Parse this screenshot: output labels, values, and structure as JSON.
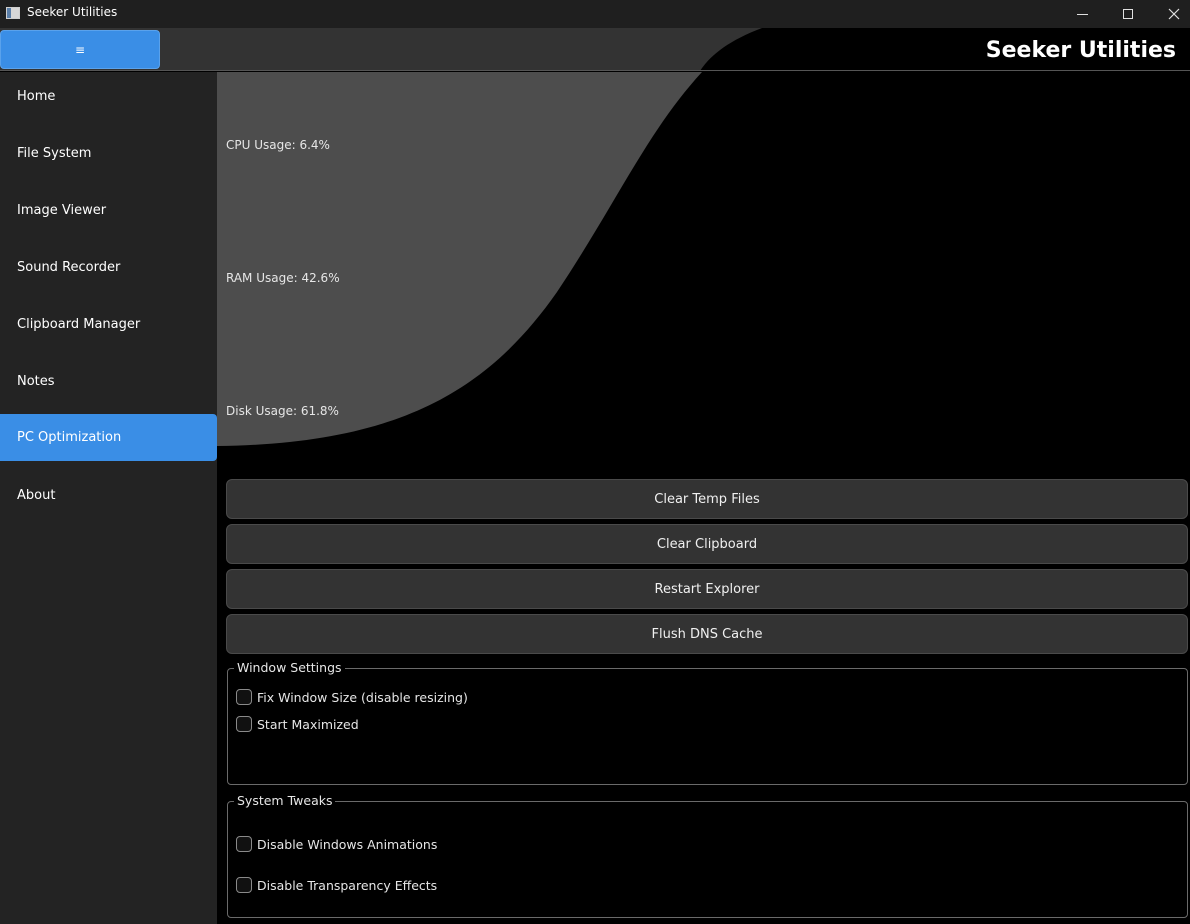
{
  "window": {
    "title": "Seeker Utilities"
  },
  "header": {
    "menu_label": "≡",
    "app_title": "Seeker Utilities"
  },
  "sidebar": {
    "items": [
      {
        "label": "Home",
        "active": false
      },
      {
        "label": "File System",
        "active": false
      },
      {
        "label": "Image Viewer",
        "active": false
      },
      {
        "label": "Sound Recorder",
        "active": false
      },
      {
        "label": "Clipboard Manager",
        "active": false
      },
      {
        "label": "Notes",
        "active": false
      },
      {
        "label": "PC Optimization",
        "active": true
      },
      {
        "label": "About",
        "active": false
      }
    ]
  },
  "stats": {
    "cpu": "CPU Usage: 6.4%",
    "ram": "RAM Usage: 42.6%",
    "disk": "Disk Usage: 61.8%"
  },
  "actions": {
    "clear_temp": "Clear Temp Files",
    "clear_clipboard": "Clear Clipboard",
    "restart_explorer": "Restart Explorer",
    "flush_dns": "Flush DNS Cache"
  },
  "window_settings": {
    "title": "Window Settings",
    "fix_size": "Fix Window Size (disable resizing)",
    "start_maximized": "Start Maximized"
  },
  "system_tweaks": {
    "title": "System Tweaks",
    "disable_animations": "Disable Windows Animations",
    "disable_transparency": "Disable Transparency Effects"
  },
  "colors": {
    "accent": "#3a8ee6",
    "sidebar_bg": "#232323",
    "button_bg": "#333333",
    "wave_fill": "#4d4d4d"
  }
}
